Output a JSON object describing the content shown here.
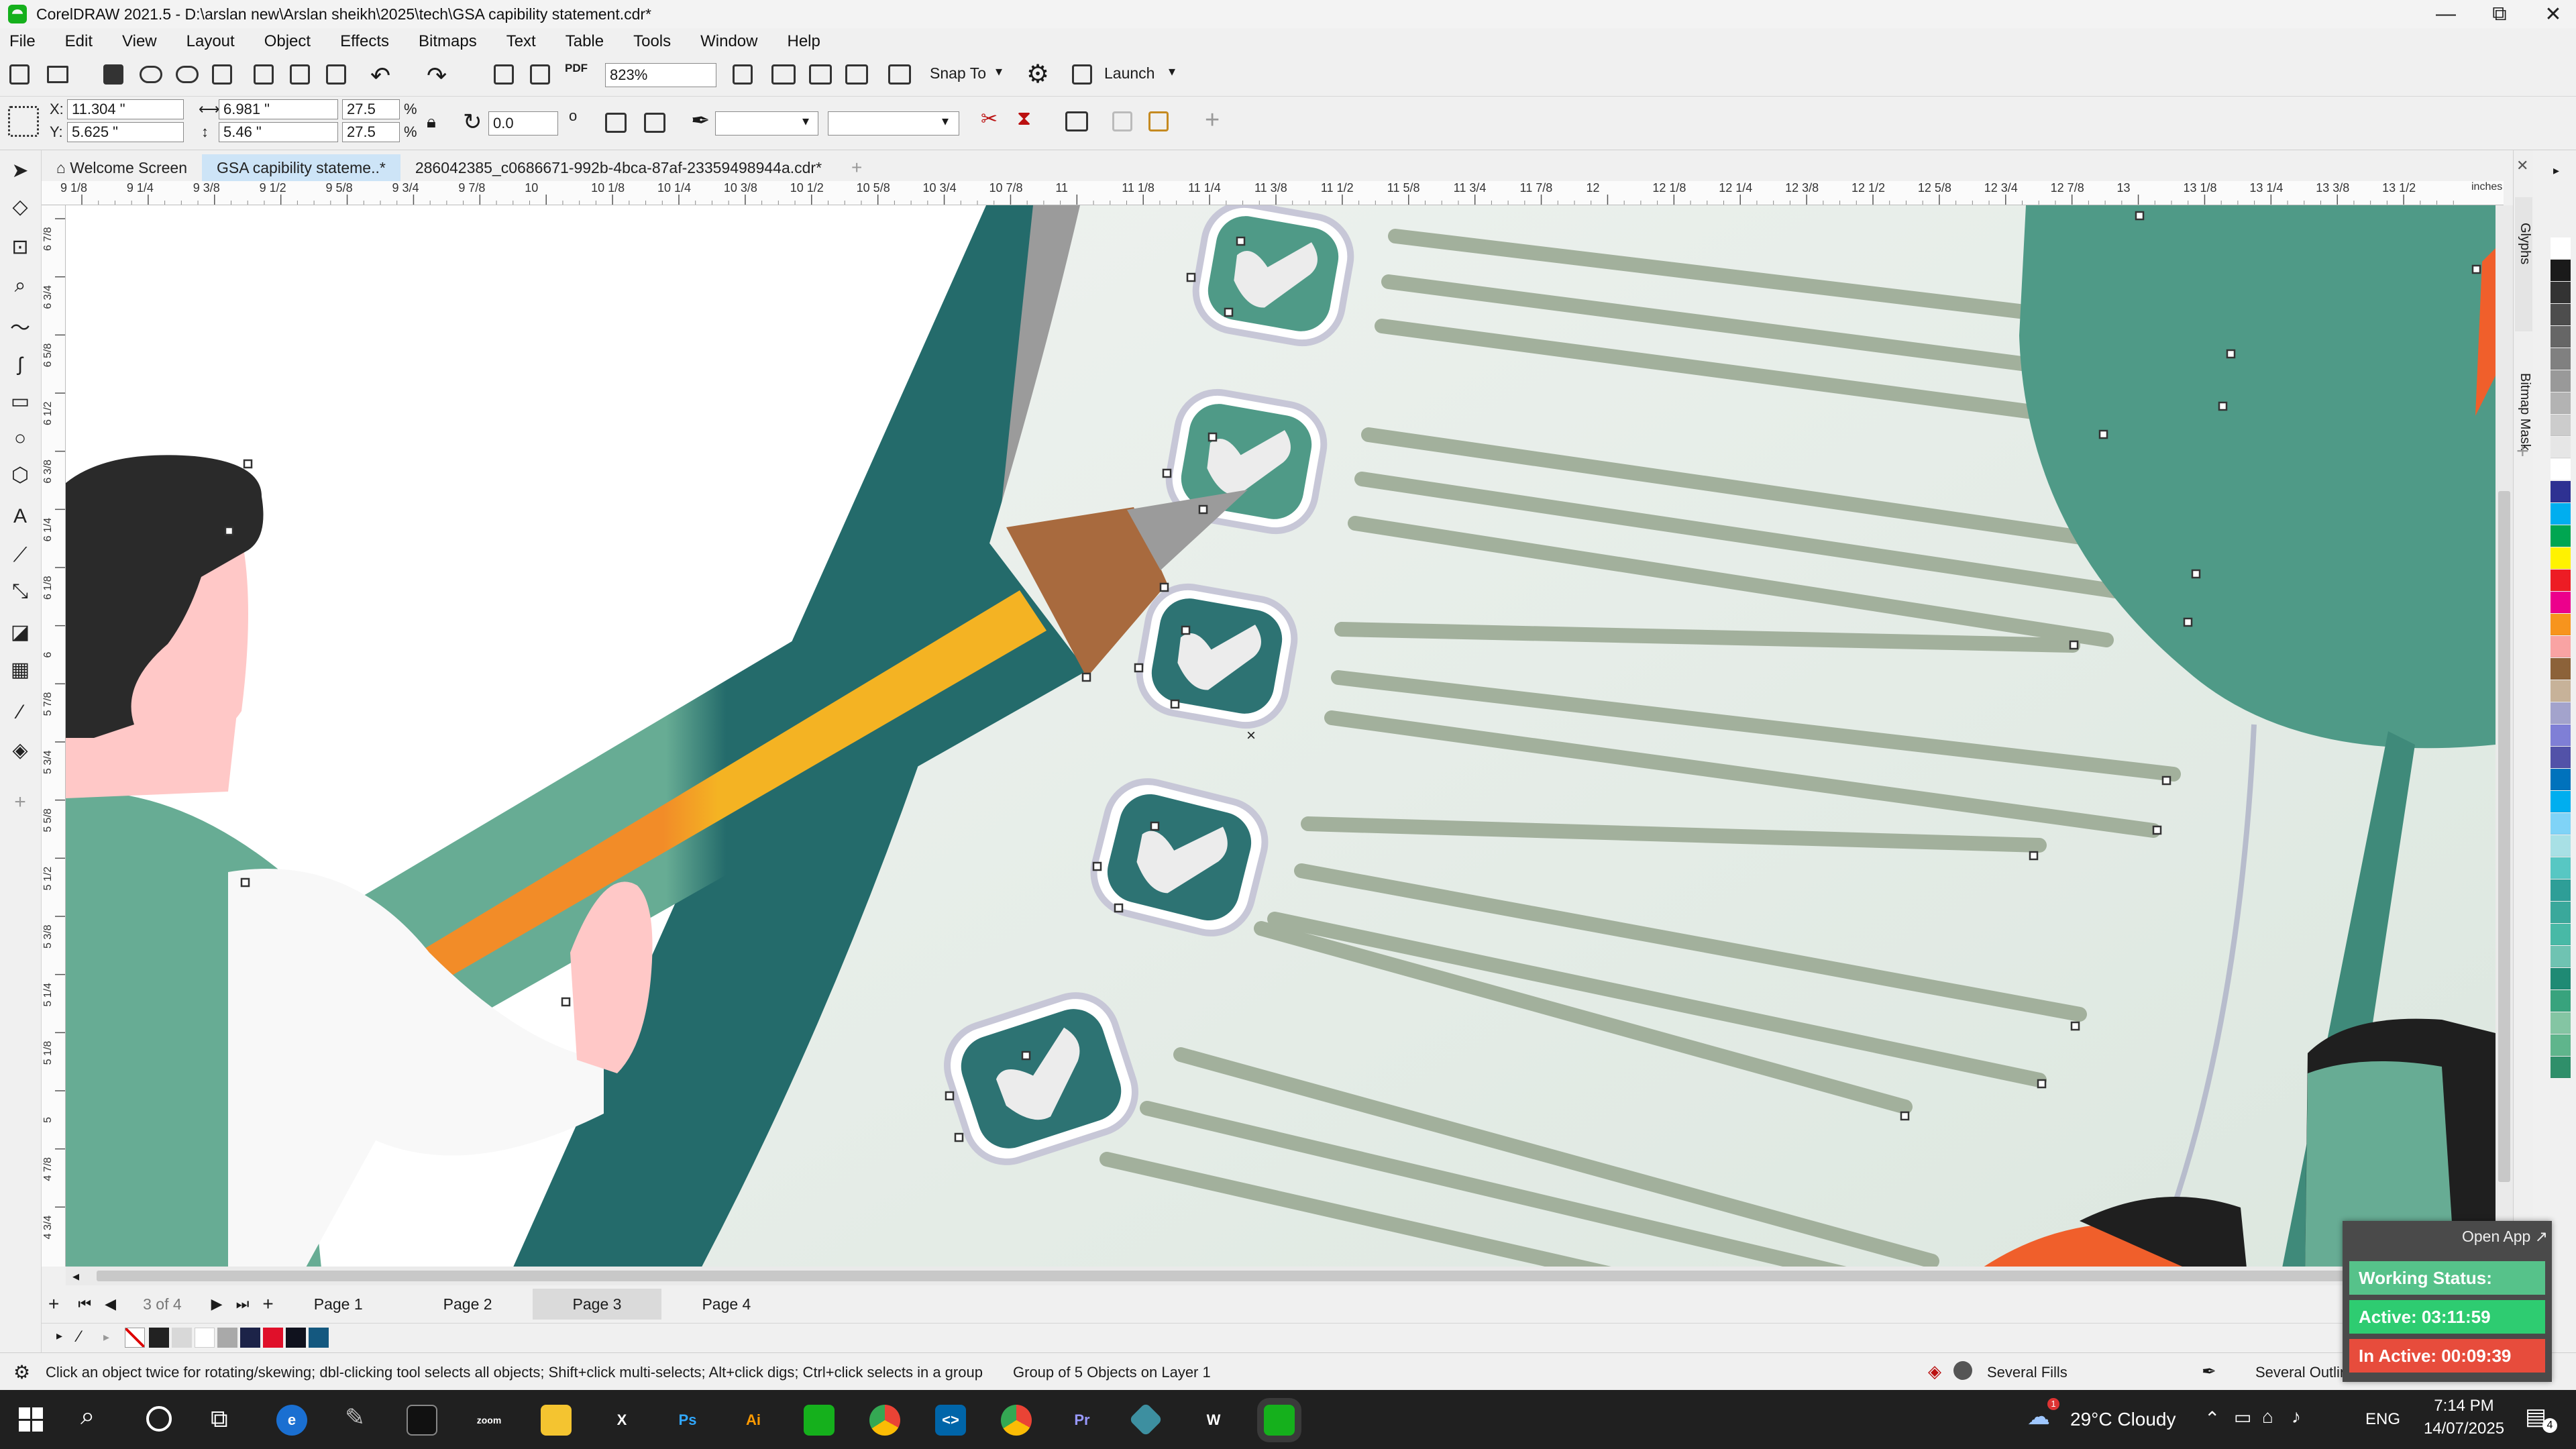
{
  "window": {
    "title": "CorelDRAW 2021.5 - D:\\arslan new\\Arslan sheikh\\2025\\tech\\GSA  capibility statement.cdr*",
    "minimize_glyph": "—",
    "maximize_glyph": "⧉",
    "close_glyph": "✕"
  },
  "menu": [
    "File",
    "Edit",
    "View",
    "Layout",
    "Object",
    "Effects",
    "Bitmaps",
    "Text",
    "Table",
    "Tools",
    "Window",
    "Help"
  ],
  "toolbar": {
    "zoom_value": "823%",
    "snap_to_label": "Snap To",
    "launch_label": "Launch",
    "pdf_label": "PDF"
  },
  "properties": {
    "x_label": "X:",
    "x_value": "11.304 \"",
    "y_label": "Y:",
    "y_value": "5.625 \"",
    "width_value": "6.981 \"",
    "height_value": "5.46 \"",
    "scale_w": "27.5",
    "scale_h": "27.5",
    "percent": "%",
    "rotation": "0.0",
    "degree": "o"
  },
  "doc_tabs": [
    {
      "label": "Welcome Screen",
      "icon": "home-icon"
    },
    {
      "label": "GSA  capibility stateme..*"
    },
    {
      "label": "286042385_c0686671-992b-4bca-87af-23359498944a.cdr*"
    }
  ],
  "new_tab_glyph": "+",
  "ruler": {
    "unit_label": "inches",
    "top_ticks": [
      "9 1/8",
      "9 1/4",
      "9 3/8",
      "9 1/2",
      "9 5/8",
      "9 3/4",
      "9 7/8",
      "10",
      "10 1/8",
      "10 1/4",
      "10 3/8",
      "10 1/2",
      "10 5/8",
      "10 3/4",
      "10 7/8",
      "11",
      "11 1/8",
      "11 1/4",
      "11 3/8",
      "11 1/2",
      "11 5/8",
      "11 3/4",
      "11 7/8",
      "12",
      "12 1/8",
      "12 1/4",
      "12 3/8",
      "12 1/2",
      "12 5/8",
      "12 3/4",
      "12 7/8",
      "13",
      "13 1/8",
      "13 1/4",
      "13 3/8",
      "13 1/2"
    ],
    "left_ticks": [
      "6 7/8",
      "6 3/4",
      "6 5/8",
      "6 1/2",
      "6 3/8",
      "6 1/4",
      "6 1/8",
      "6",
      "5 7/8",
      "5 3/4",
      "5 5/8",
      "5 1/2",
      "5 3/8",
      "5 1/4",
      "5 1/8",
      "5",
      "4 7/8",
      "4 3/4"
    ]
  },
  "pages": {
    "counter": "3 of 4",
    "tabs": [
      "Page 1",
      "Page 2",
      "Page 3",
      "Page 4"
    ],
    "active": "Page 3"
  },
  "docker_tabs": [
    "Glyphs",
    "Bitmap Mask"
  ],
  "status": {
    "hint": "Click an object twice for rotating/skewing; dbl-clicking tool selects all objects; Shift+click multi-selects; Alt+click digs; Ctrl+click selects in a group",
    "selection": "Group of 5 Objects on Layer 1",
    "fill": "Several Fills",
    "outline": "Several Outlines"
  },
  "tracker": {
    "open_app": "Open App ↗",
    "working_status": "Working Status: Active",
    "active_time": "Active: 03:11:59",
    "inactive_time": "In Active: 00:09:39"
  },
  "taskbar": {
    "weather": "29°C  Cloudy",
    "language": "ENG",
    "time": "7:14 PM",
    "date": "14/07/2025",
    "notification_count": "4",
    "chrome_badge": "1",
    "apps": [
      {
        "name": "zoom",
        "label": "zoom",
        "color": "#2d8cff"
      },
      {
        "name": "excel",
        "label": "X",
        "color": "#107c41"
      },
      {
        "name": "photoshop",
        "label": "Ps",
        "color": "#0b2946"
      },
      {
        "name": "illustrator",
        "label": "Ai",
        "color": "#330000"
      },
      {
        "name": "premiere",
        "label": "Pr",
        "color": "#1f0a3c"
      },
      {
        "name": "word",
        "label": "W",
        "color": "#185abd"
      }
    ]
  },
  "colors": {
    "teal_dark": "#246b6b",
    "teal_mid": "#4f9a87",
    "teal_light": "#67ac94",
    "paper": "#e3ebe5",
    "line_green": "#a2b09c",
    "pencil_yellow": "#f4b323",
    "pencil_orange": "#f28c28",
    "wood": "#a86a3e",
    "hair": "#2a2a2a",
    "skin": "#ffc8c7",
    "tracker_green": "#2ecc71",
    "tracker_red": "#e74c3c"
  }
}
